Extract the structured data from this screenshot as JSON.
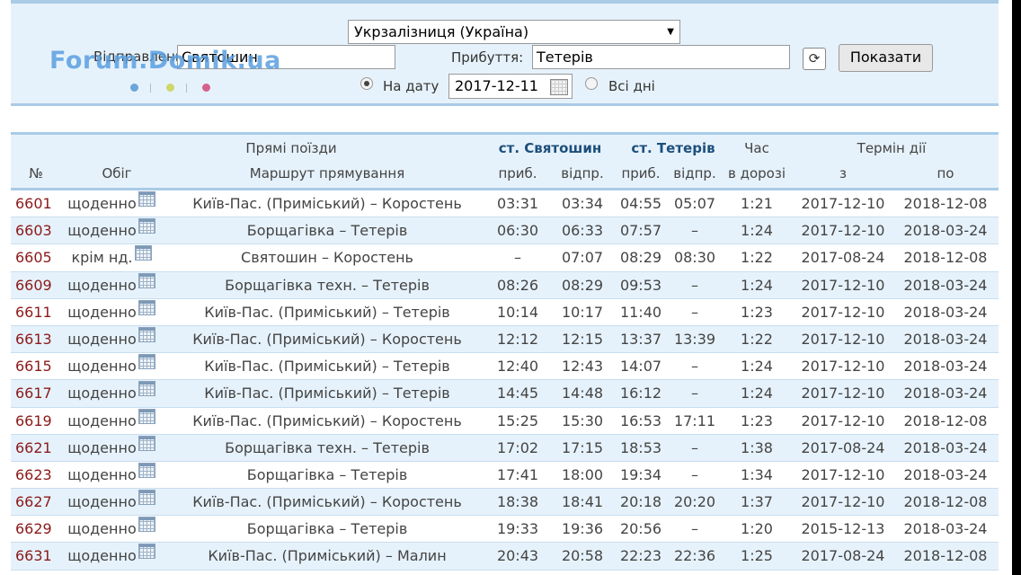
{
  "form": {
    "railway": "Укрзалізниця (Україна)",
    "departure_label": "Відправлення:",
    "departure_value": "Святошин",
    "arrival_label": "Прибуття:",
    "arrival_value": "Тетерів",
    "show_button": "Показати",
    "date_radio_label": "На дату",
    "date_value": "2017-12-11",
    "all_days_label": "Всі дні",
    "date_mode": "date"
  },
  "watermark": "Forum.Domik.ua",
  "header": {
    "direct_trains": "Прямі поїзди",
    "num": "№",
    "circulation": "Обіг",
    "route": "Маршрут прямування",
    "station_from": "ст. Святошин",
    "station_to": "ст. Тетерів",
    "arr": "приб.",
    "dep": "відпр.",
    "arr2": "приб.",
    "dep2": "відпр.",
    "travel_time_1": "Час",
    "travel_time_2": "в дорозі",
    "validity": "Термін дії",
    "valid_from": "з",
    "valid_to": "по"
  },
  "trains": [
    {
      "num": "6601",
      "days": "щоденно",
      "route": "Київ-Пас. (Приміський) – Коростень",
      "arr_from": "03:31",
      "dep_from": "03:34",
      "arr_to": "04:55",
      "dep_to": "05:07",
      "travel": "1:21",
      "from": "2017-12-10",
      "to": "2018-12-08"
    },
    {
      "num": "6603",
      "days": "щоденно",
      "route": "Борщагівка – Тетерів",
      "arr_from": "06:30",
      "dep_from": "06:33",
      "arr_to": "07:57",
      "dep_to": "–",
      "travel": "1:24",
      "from": "2017-12-10",
      "to": "2018-03-24"
    },
    {
      "num": "6605",
      "days": "крім нд.",
      "route": "Святошин – Коростень",
      "arr_from": "–",
      "dep_from": "07:07",
      "arr_to": "08:29",
      "dep_to": "08:30",
      "travel": "1:22",
      "from": "2017-08-24",
      "to": "2018-12-08"
    },
    {
      "num": "6609",
      "days": "щоденно",
      "route": "Борщагівка техн. – Тетерів",
      "arr_from": "08:26",
      "dep_from": "08:29",
      "arr_to": "09:53",
      "dep_to": "–",
      "travel": "1:24",
      "from": "2017-12-10",
      "to": "2018-03-24"
    },
    {
      "num": "6611",
      "days": "щоденно",
      "route": "Київ-Пас. (Приміський) – Тетерів",
      "arr_from": "10:14",
      "dep_from": "10:17",
      "arr_to": "11:40",
      "dep_to": "–",
      "travel": "1:23",
      "from": "2017-12-10",
      "to": "2018-03-24"
    },
    {
      "num": "6613",
      "days": "щоденно",
      "route": "Київ-Пас. (Приміський) – Коростень",
      "arr_from": "12:12",
      "dep_from": "12:15",
      "arr_to": "13:37",
      "dep_to": "13:39",
      "travel": "1:22",
      "from": "2017-12-10",
      "to": "2018-03-24"
    },
    {
      "num": "6615",
      "days": "щоденно",
      "route": "Київ-Пас. (Приміський) – Тетерів",
      "arr_from": "12:40",
      "dep_from": "12:43",
      "arr_to": "14:07",
      "dep_to": "–",
      "travel": "1:24",
      "from": "2017-12-10",
      "to": "2018-03-24"
    },
    {
      "num": "6617",
      "days": "щоденно",
      "route": "Київ-Пас. (Приміський) – Тетерів",
      "arr_from": "14:45",
      "dep_from": "14:48",
      "arr_to": "16:12",
      "dep_to": "–",
      "travel": "1:24",
      "from": "2017-12-10",
      "to": "2018-03-24"
    },
    {
      "num": "6619",
      "days": "щоденно",
      "route": "Київ-Пас. (Приміський) – Коростень",
      "arr_from": "15:25",
      "dep_from": "15:30",
      "arr_to": "16:53",
      "dep_to": "17:11",
      "travel": "1:23",
      "from": "2017-12-10",
      "to": "2018-12-08"
    },
    {
      "num": "6621",
      "days": "щоденно",
      "route": "Борщагівка техн. – Тетерів",
      "arr_from": "17:02",
      "dep_from": "17:15",
      "arr_to": "18:53",
      "dep_to": "–",
      "travel": "1:38",
      "from": "2017-08-24",
      "to": "2018-03-24"
    },
    {
      "num": "6623",
      "days": "щоденно",
      "route": "Борщагівка – Тетерів",
      "arr_from": "17:41",
      "dep_from": "18:00",
      "arr_to": "19:34",
      "dep_to": "–",
      "travel": "1:34",
      "from": "2017-12-10",
      "to": "2018-03-24"
    },
    {
      "num": "6627",
      "days": "щоденно",
      "route": "Київ-Пас. (Приміський) – Коростень",
      "arr_from": "18:38",
      "dep_from": "18:41",
      "arr_to": "20:18",
      "dep_to": "20:20",
      "travel": "1:37",
      "from": "2017-12-10",
      "to": "2018-12-08"
    },
    {
      "num": "6629",
      "days": "щоденно",
      "route": "Борщагівка – Тетерів",
      "arr_from": "19:33",
      "dep_from": "19:36",
      "arr_to": "20:56",
      "dep_to": "–",
      "travel": "1:20",
      "from": "2015-12-13",
      "to": "2018-03-24"
    },
    {
      "num": "6631",
      "days": "щоденно",
      "route": "Київ-Пас. (Приміський) – Малин",
      "arr_from": "20:43",
      "dep_from": "20:58",
      "arr_to": "22:23",
      "dep_to": "22:36",
      "travel": "1:25",
      "from": "2017-08-24",
      "to": "2018-12-08"
    }
  ],
  "colors": {
    "panel_bg": "#e6f2fb",
    "panel_border": "#a9cbe6",
    "train_number": "#8b1a1a",
    "station_header": "#1d4f7c"
  }
}
